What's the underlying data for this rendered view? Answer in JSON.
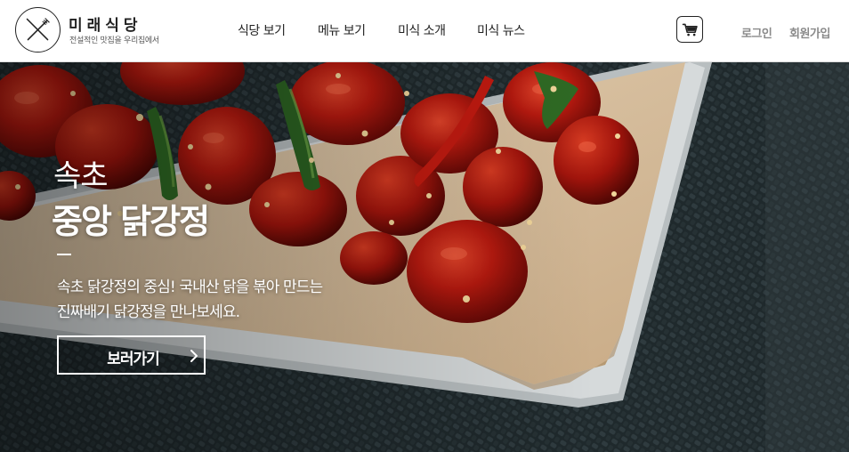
{
  "brand": {
    "name": "미래식당",
    "tagline": "전설적인 맛집을 우리집에서",
    "logo_icon": "fork-knife-icon"
  },
  "nav": {
    "items": [
      {
        "label": "식당 보기"
      },
      {
        "label": "메뉴 보기"
      },
      {
        "label": "미식 소개"
      },
      {
        "label": "미식 뉴스"
      }
    ]
  },
  "cart": {
    "icon": "cart-icon"
  },
  "auth": {
    "login": "로그인",
    "signup": "회원가입"
  },
  "hero": {
    "subtitle": "속초",
    "title": "중앙 닭강정",
    "description_lines": [
      "속초 닭강정의 중심! 국내산 닭을 볶아 만드는",
      "진짜배기 닭강정을 만나보세요."
    ],
    "cta_label": "보러가기",
    "cta_icon": "chevron-right-icon"
  },
  "colors": {
    "header_bg": "#ffffff",
    "nav_text": "#222222",
    "auth_text": "#8a8a8a",
    "hero_text": "#ffffff",
    "sauce_red": "#a8160f",
    "paper": "#d9c2a2",
    "mat": "#1d2528"
  }
}
